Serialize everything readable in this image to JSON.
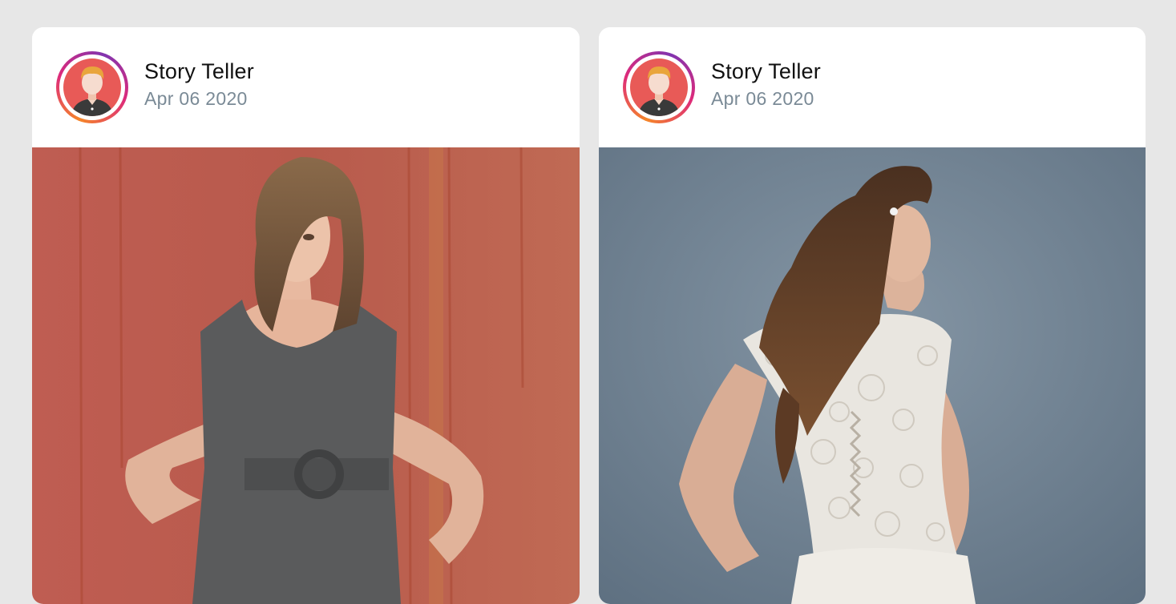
{
  "feed": {
    "posts": [
      {
        "author": "Story Teller",
        "date": "Apr 06 2020",
        "photo": {
          "subject": "woman-grey-dress-red-wall",
          "background_color": "#b8574a"
        }
      },
      {
        "author": "Story Teller",
        "date": "Apr 06 2020",
        "photo": {
          "subject": "woman-lace-bridal-dress-back-view",
          "background_color": "#6a7b8a"
        }
      }
    ]
  },
  "colors": {
    "page_background": "#e7e7e7",
    "card_background": "#ffffff",
    "date_text": "#7a8a96",
    "avatar_background": "#e85a57",
    "story_ring": [
      "#f58529",
      "#dd2a7b",
      "#8134af"
    ]
  },
  "icons": {
    "avatar": "person-avatar-icon"
  }
}
